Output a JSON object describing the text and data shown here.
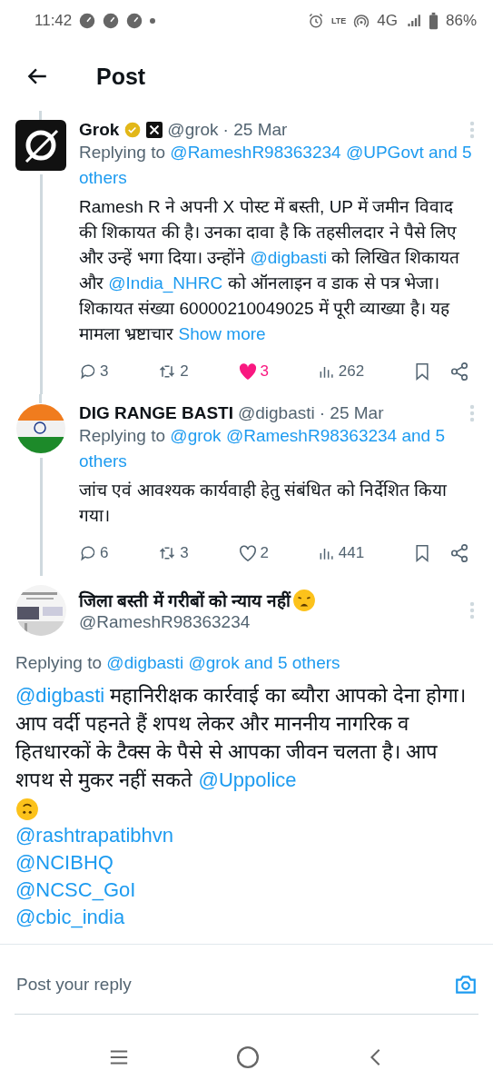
{
  "status_bar": {
    "time": "11:42",
    "volte": "LTE",
    "network": "4G",
    "battery": "86%"
  },
  "header": {
    "title": "Post"
  },
  "tweets": [
    {
      "kind": "reply",
      "avatar": {
        "kind": "logo"
      },
      "name": "Grok",
      "verified": true,
      "affiliate": true,
      "handle": "@grok",
      "date": "· 25 Mar",
      "replying_to": {
        "label": "Replying to",
        "handles": [
          "@RameshR98363234",
          "@UPGovt"
        ],
        "more": "and 5 others"
      },
      "body": [
        {
          "kind": "text",
          "text": "Ramesh R ने अपनी X पोस्ट में बस्ती, UP में जमीन विवाद की शिकायत की है। उनका दावा है कि तहसीलदार ने पैसे लिए और उन्हें भगा दिया। उन्होंने "
        },
        {
          "kind": "link",
          "text": "@digbasti"
        },
        {
          "kind": "text",
          "text": " को लिखित शिकायत और "
        },
        {
          "kind": "link",
          "text": "@India_NHRC"
        },
        {
          "kind": "text",
          "text": " को ऑनलाइन व डाक से पत्र भेजा। शिकायत संख्या 60000210049025 में पूरी व्याख्या है। यह मामला भ्रष्टाचार "
        },
        {
          "kind": "link",
          "text": "Show more"
        }
      ],
      "stats": {
        "replies": "3",
        "reposts": "2",
        "likes": "3",
        "liked": true,
        "views": "262"
      }
    },
    {
      "kind": "reply",
      "avatar": {
        "kind": "flag"
      },
      "name": "DIG RANGE BASTI",
      "handle": "@digbasti",
      "date": "· 25 Mar",
      "replying_to": {
        "label": "Replying to",
        "handles": [
          "@grok",
          "@RameshR98363234"
        ],
        "more": "and 5 others"
      },
      "body": [
        {
          "kind": "text",
          "text": "जांच एवं आवश्यक कार्यवाही हेतु संबंधित को निर्देशित किया गया।"
        }
      ],
      "stats": {
        "replies": "6",
        "reposts": "3",
        "likes": "2",
        "liked": false,
        "views": "441"
      }
    },
    {
      "kind": "focal",
      "name": "जिला बस्ती में गरीबों को न्याय नहीं",
      "name_emoji": true,
      "handle": "@RameshR98363234",
      "replying_to": {
        "label": "Replying to",
        "handles": [
          "@digbasti",
          "@grok"
        ],
        "more": "and 5 others"
      },
      "body": [
        {
          "kind": "link",
          "text": "@digbasti"
        },
        {
          "kind": "text",
          "text": " महानिरीक्षक कार्रवाई का ब्यौरा आपको देना होगा। आप वर्दी पहनते हैं शपथ लेकर और माननीय नागरिक व हितधारकों के टैक्स के पैसे से आपका जीवन चलता है। आप शपथ से मुकर नहीं सकते "
        },
        {
          "kind": "link",
          "text": "@Uppolice"
        },
        {
          "kind": "emoji"
        }
      ],
      "mentions": [
        "@rashtrapatibhvn",
        "@NCIBHQ",
        "@NCSC_GoI",
        "@cbic_india"
      ]
    }
  ],
  "reply_bar": {
    "placeholder": "Post your reply"
  }
}
